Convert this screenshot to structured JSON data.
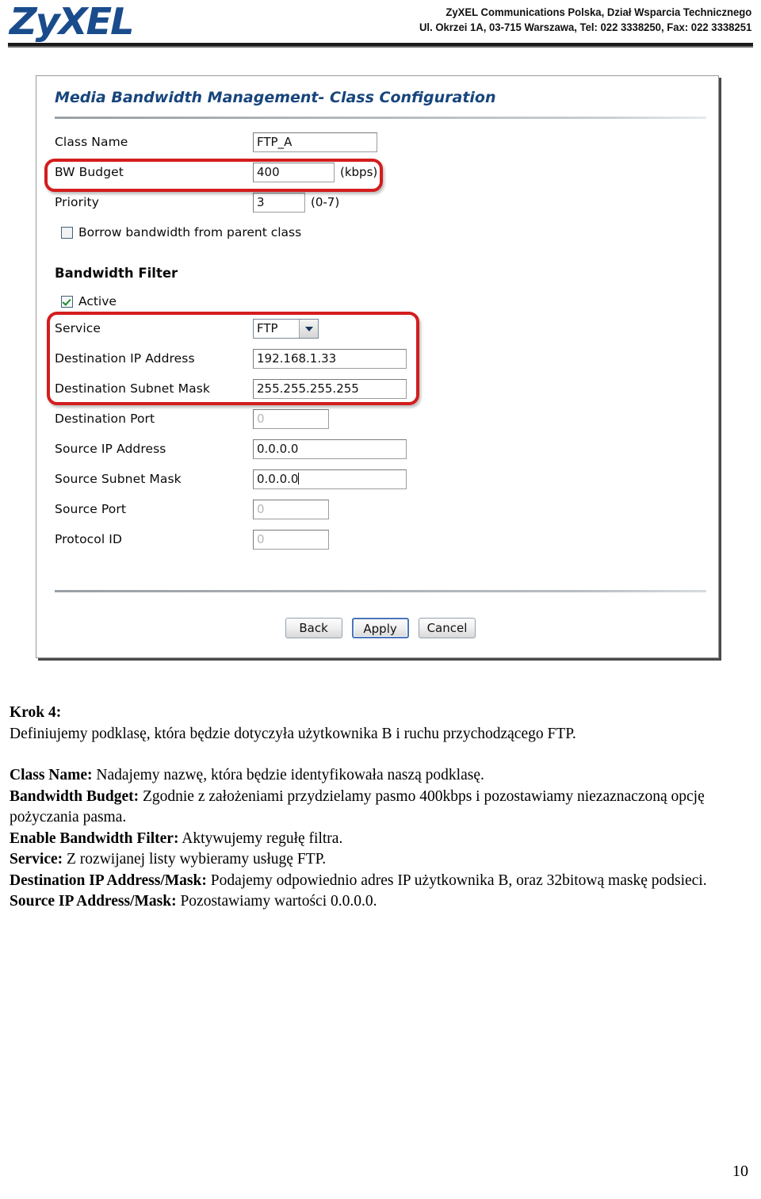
{
  "header": {
    "logo": "ZyXEL",
    "company_line1": "ZyXEL Communications Polska, Dział Wsparcia Technicznego",
    "company_line2": "Ul. Okrzei 1A, 03-715 Warszawa, Tel: 022 3338250, Fax: 022 3338251"
  },
  "screenshot": {
    "title": "Media Bandwidth Management- Class Configuration",
    "class_config": {
      "class_name_label": "Class Name",
      "class_name_value": "FTP_A",
      "bw_budget_label": "BW Budget",
      "bw_budget_value": "400",
      "bw_budget_suffix": "(kbps)",
      "priority_label": "Priority",
      "priority_value": "3",
      "priority_suffix": "(0-7)",
      "borrow_label": "Borrow bandwidth from parent class",
      "borrow_checked": false
    },
    "bandwidth_filter": {
      "section_title": "Bandwidth Filter",
      "active_label": "Active",
      "active_checked": true,
      "service_label": "Service",
      "service_value": "FTP",
      "service_options": [
        "FTP"
      ],
      "dest_ip_label": "Destination IP Address",
      "dest_ip_value": "192.168.1.33",
      "dest_mask_label": "Destination Subnet Mask",
      "dest_mask_value": "255.255.255.255",
      "dest_port_label": "Destination Port",
      "dest_port_value": "0",
      "src_ip_label": "Source IP Address",
      "src_ip_value": "0.0.0.0",
      "src_mask_label": "Source Subnet Mask",
      "src_mask_value": "0.0.0.0",
      "src_port_label": "Source Port",
      "src_port_value": "0",
      "protocol_id_label": "Protocol ID",
      "protocol_id_value": "0"
    },
    "buttons": {
      "back": "Back",
      "apply": "Apply",
      "cancel": "Cancel"
    },
    "highlight_color": "#d31d1d"
  },
  "document": {
    "step_heading": "Krok 4:",
    "step_intro": "Definiujemy podklasę, która będzie dotyczyła użytkownika B i ruchu przychodzącego FTP.",
    "items": [
      {
        "term": "Class Name:",
        "text": " Nadajemy nazwę, która będzie identyfikowała naszą podklasę."
      },
      {
        "term": "Bandwidth Budget:",
        "text": " Zgodnie z założeniami przydzielamy pasmo 400kbps i pozostawiamy niezaznaczoną opcję pożyczania pasma."
      },
      {
        "term": "Enable Bandwidth Filter:",
        "text": " Aktywujemy regułę filtra."
      },
      {
        "term": "Service:",
        "text": " Z rozwijanej listy wybieramy usługę FTP."
      },
      {
        "term": "Destination IP Address/Mask:",
        "text": " Podajemy odpowiednio adres IP użytkownika B, oraz 32bitową maskę podsieci."
      },
      {
        "term": "Source IP Address/Mask:",
        "text": " Pozostawiamy wartości 0.0.0.0."
      }
    ]
  },
  "footer": {
    "page_number": "10"
  }
}
